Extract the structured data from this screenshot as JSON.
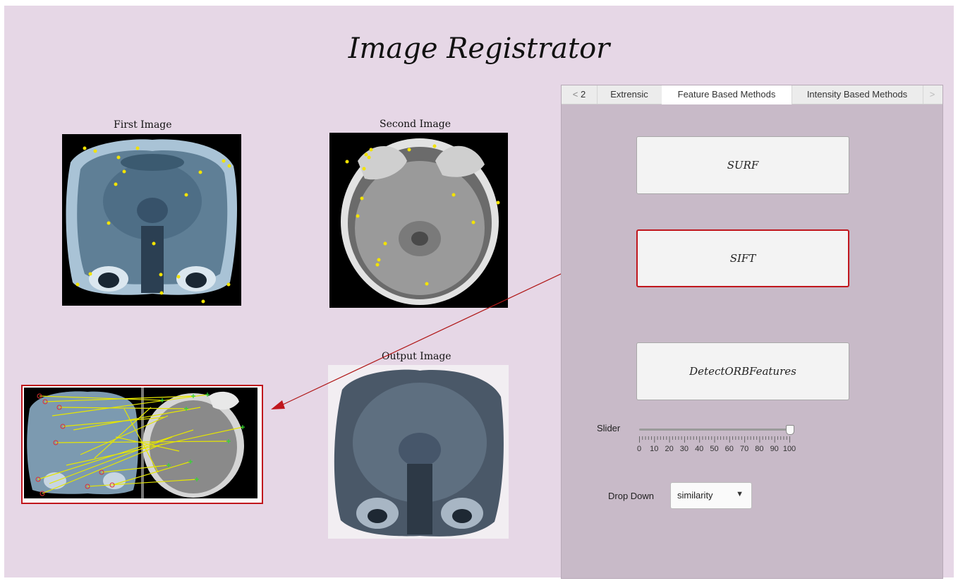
{
  "app": {
    "title": "Image Registrator"
  },
  "images": {
    "first": {
      "caption": "First Image"
    },
    "second": {
      "caption": "Second Image"
    },
    "output": {
      "caption": "Output Image"
    }
  },
  "tabs": {
    "prev": "<",
    "page": "2",
    "items": [
      "Extrensic",
      "Feature Based Methods",
      "Intensity Based Methods"
    ],
    "active": "Feature Based Methods",
    "next": ">"
  },
  "methods": {
    "surf_label": "SURF",
    "sift_label": "SIFT",
    "orb_label": "DetectORBFeatures"
  },
  "slider": {
    "label": "Slider",
    "value": 100,
    "min": 0,
    "max": 100,
    "tick_labels": [
      "0",
      "10",
      "20",
      "30",
      "40",
      "50",
      "60",
      "70",
      "80",
      "90",
      "100"
    ]
  },
  "dropdown": {
    "label": "Drop Down",
    "value": "similarity"
  },
  "colors": {
    "background": "#e6d7e6",
    "panel": "#c8bac8",
    "highlight": "#c0161d",
    "keypoint": "#f2e300"
  }
}
